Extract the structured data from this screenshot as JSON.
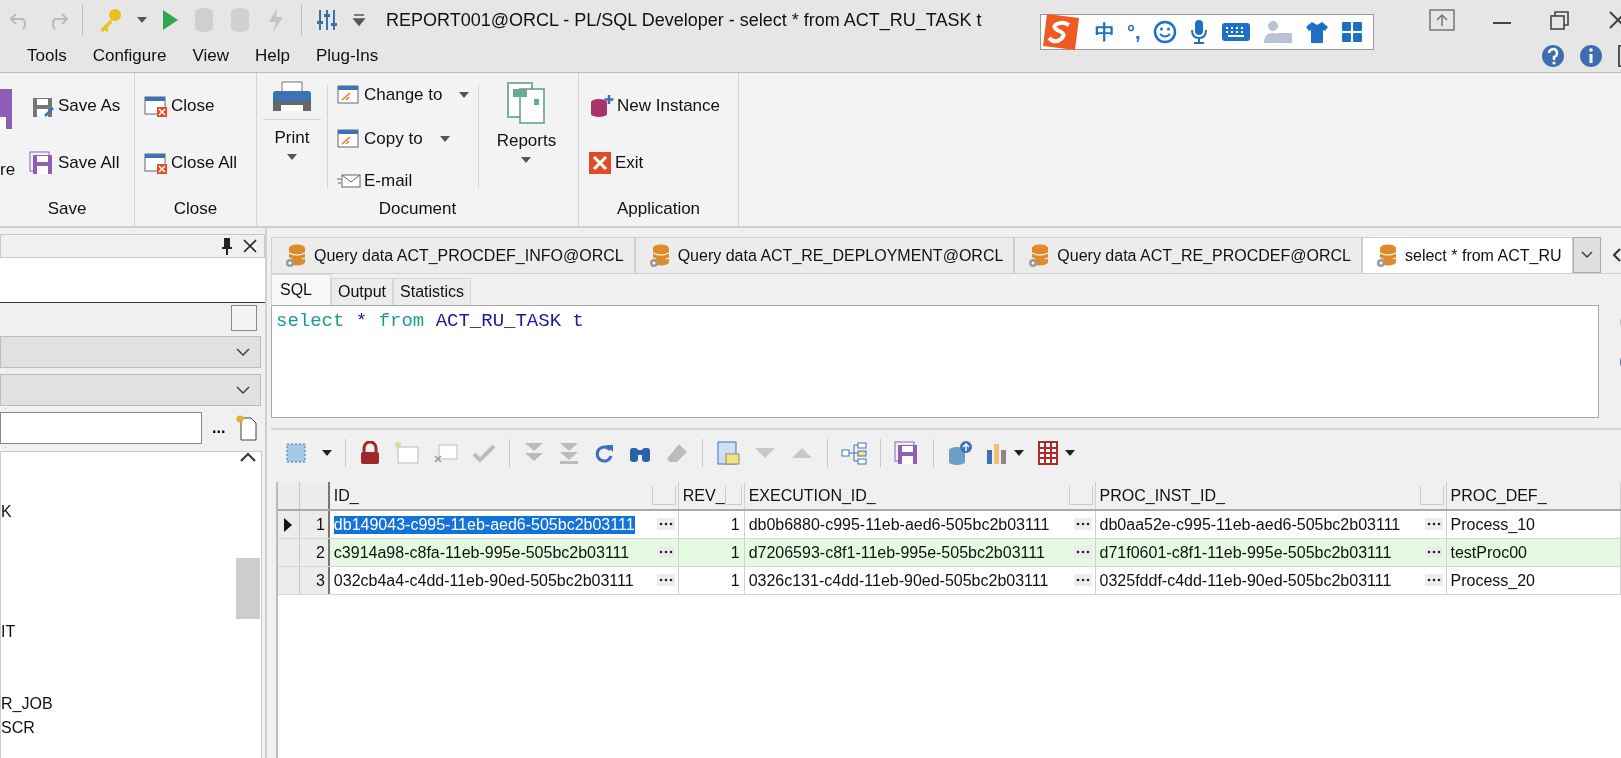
{
  "title_bar": {
    "title": "REPORT001@ORCL - PL/SQL Developer - select * from ACT_RU_TASK t"
  },
  "ime_toolbar": {
    "mode": "中",
    "punctuation": "°,"
  },
  "menu": [
    "Tools",
    "Configure",
    "View",
    "Help",
    "Plug-Ins"
  ],
  "ribbon": {
    "save_group": {
      "cut_label": "re",
      "buttons": [
        "Save As",
        "Save All"
      ],
      "label": "Save"
    },
    "close_group": {
      "buttons": [
        "Close",
        "Close All"
      ],
      "label": "Close"
    },
    "document_group": {
      "print": "Print",
      "buttons": [
        {
          "label": "Change to",
          "dropdown": true
        },
        {
          "label": "Copy to",
          "dropdown": true
        },
        {
          "label": "E-mail",
          "dropdown": false
        }
      ],
      "reports": "Reports",
      "label": "Document"
    },
    "application_group": {
      "buttons": [
        "New Instance",
        "Exit"
      ],
      "label": "Application"
    }
  },
  "browser_panel": {
    "browse_button": "...",
    "tree_items": [
      "K",
      "IT",
      "R_JOB",
      "SCR"
    ]
  },
  "document_tabs": [
    {
      "label": "Query data ACT_PROCDEF_INFO@ORCL",
      "selected": false
    },
    {
      "label": "Query data ACT_RE_DEPLOYMENT@ORCL",
      "selected": false
    },
    {
      "label": "Query data ACT_RE_PROCDEF@ORCL",
      "selected": false
    },
    {
      "label": "select * from ACT_RU",
      "selected": true
    }
  ],
  "editor_tabs": [
    {
      "label": "SQL",
      "selected": true
    },
    {
      "label": "Output",
      "selected": false
    },
    {
      "label": "Statistics",
      "selected": false
    }
  ],
  "editor": {
    "tokens": [
      {
        "kind": "keyword",
        "text": "select"
      },
      {
        "kind": "identifier",
        "text": "*"
      },
      {
        "kind": "keyword",
        "text": "from"
      },
      {
        "kind": "identifier",
        "text": "ACT_RU_TASK t"
      }
    ]
  },
  "grid": {
    "columns": [
      {
        "label": "ID_",
        "kind": "text"
      },
      {
        "label": "REV_",
        "kind": "number"
      },
      {
        "label": "EXECUTION_ID_",
        "kind": "text"
      },
      {
        "label": "PROC_INST_ID_",
        "kind": "text"
      },
      {
        "label": "PROC_DEF_",
        "kind": "text"
      }
    ],
    "rows": [
      {
        "number": "1",
        "current": true,
        "shaded": false,
        "selected": true,
        "cells": [
          "db149043-c995-11eb-aed6-505bc2b03111",
          "1",
          "db0b6880-c995-11eb-aed6-505bc2b03111",
          "db0aa52e-c995-11eb-aed6-505bc2b03111",
          "Process_10"
        ]
      },
      {
        "number": "2",
        "current": false,
        "shaded": true,
        "selected": false,
        "cells": [
          "c3914a98-c8fa-11eb-995e-505bc2b03111",
          "1",
          "d7206593-c8f1-11eb-995e-505bc2b03111",
          "d71f0601-c8f1-11eb-995e-505bc2b03111",
          "testProc00"
        ]
      },
      {
        "number": "3",
        "current": false,
        "shaded": false,
        "selected": false,
        "cells": [
          "032cb4a4-c4dd-11eb-90ed-505bc2b03111",
          "1",
          "0326c131-c4dd-11eb-90ed-505bc2b03111",
          "0325fddf-c4dd-11eb-90ed-505bc2b03111",
          "Process_20"
        ]
      }
    ]
  }
}
